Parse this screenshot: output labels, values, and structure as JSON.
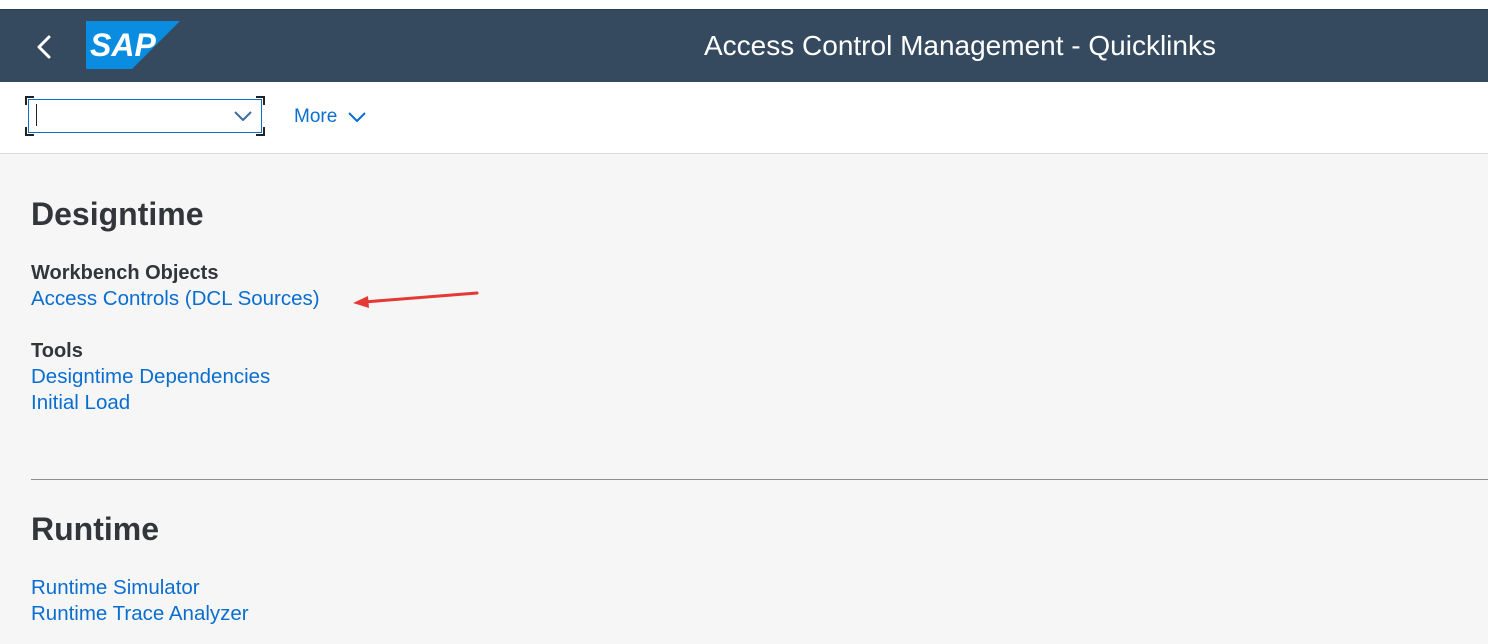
{
  "shell": {
    "title": "Access Control Management - Quicklinks",
    "logo_text": "SAP",
    "colors": {
      "shell_bg": "#354a5f",
      "logo_blue": "#0a8de1",
      "link": "#0a6ed1"
    }
  },
  "toolbar": {
    "combo_value": "",
    "more_label": "More"
  },
  "sections": [
    {
      "title": "Designtime",
      "groups": [
        {
          "title": "Workbench Objects",
          "links": [
            "Access Controls (DCL Sources)"
          ]
        },
        {
          "title": "Tools",
          "links": [
            "Designtime Dependencies",
            "Initial Load"
          ]
        }
      ]
    },
    {
      "title": "Runtime",
      "groups": [
        {
          "title": "",
          "links": [
            "Runtime Simulator",
            "Runtime Trace Analyzer"
          ]
        }
      ]
    }
  ],
  "annotation": {
    "icon": "red-arrow-icon",
    "color": "#e53935"
  }
}
